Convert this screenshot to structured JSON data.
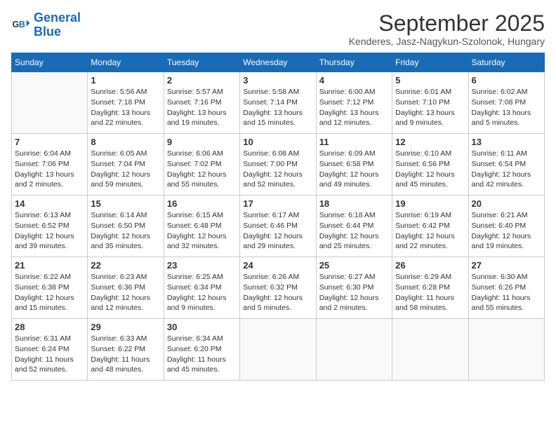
{
  "header": {
    "logo_line1": "General",
    "logo_line2": "Blue",
    "month": "September 2025",
    "location": "Kenderes, Jasz-Nagykun-Szolonok, Hungary"
  },
  "weekdays": [
    "Sunday",
    "Monday",
    "Tuesday",
    "Wednesday",
    "Thursday",
    "Friday",
    "Saturday"
  ],
  "weeks": [
    [
      {
        "day": "",
        "info": ""
      },
      {
        "day": "1",
        "info": "Sunrise: 5:56 AM\nSunset: 7:18 PM\nDaylight: 13 hours\nand 22 minutes."
      },
      {
        "day": "2",
        "info": "Sunrise: 5:57 AM\nSunset: 7:16 PM\nDaylight: 13 hours\nand 19 minutes."
      },
      {
        "day": "3",
        "info": "Sunrise: 5:58 AM\nSunset: 7:14 PM\nDaylight: 13 hours\nand 15 minutes."
      },
      {
        "day": "4",
        "info": "Sunrise: 6:00 AM\nSunset: 7:12 PM\nDaylight: 13 hours\nand 12 minutes."
      },
      {
        "day": "5",
        "info": "Sunrise: 6:01 AM\nSunset: 7:10 PM\nDaylight: 13 hours\nand 9 minutes."
      },
      {
        "day": "6",
        "info": "Sunrise: 6:02 AM\nSunset: 7:08 PM\nDaylight: 13 hours\nand 5 minutes."
      }
    ],
    [
      {
        "day": "7",
        "info": "Sunrise: 6:04 AM\nSunset: 7:06 PM\nDaylight: 13 hours\nand 2 minutes."
      },
      {
        "day": "8",
        "info": "Sunrise: 6:05 AM\nSunset: 7:04 PM\nDaylight: 12 hours\nand 59 minutes."
      },
      {
        "day": "9",
        "info": "Sunrise: 6:06 AM\nSunset: 7:02 PM\nDaylight: 12 hours\nand 55 minutes."
      },
      {
        "day": "10",
        "info": "Sunrise: 6:08 AM\nSunset: 7:00 PM\nDaylight: 12 hours\nand 52 minutes."
      },
      {
        "day": "11",
        "info": "Sunrise: 6:09 AM\nSunset: 6:58 PM\nDaylight: 12 hours\nand 49 minutes."
      },
      {
        "day": "12",
        "info": "Sunrise: 6:10 AM\nSunset: 6:56 PM\nDaylight: 12 hours\nand 45 minutes."
      },
      {
        "day": "13",
        "info": "Sunrise: 6:11 AM\nSunset: 6:54 PM\nDaylight: 12 hours\nand 42 minutes."
      }
    ],
    [
      {
        "day": "14",
        "info": "Sunrise: 6:13 AM\nSunset: 6:52 PM\nDaylight: 12 hours\nand 39 minutes."
      },
      {
        "day": "15",
        "info": "Sunrise: 6:14 AM\nSunset: 6:50 PM\nDaylight: 12 hours\nand 35 minutes."
      },
      {
        "day": "16",
        "info": "Sunrise: 6:15 AM\nSunset: 6:48 PM\nDaylight: 12 hours\nand 32 minutes."
      },
      {
        "day": "17",
        "info": "Sunrise: 6:17 AM\nSunset: 6:46 PM\nDaylight: 12 hours\nand 29 minutes."
      },
      {
        "day": "18",
        "info": "Sunrise: 6:18 AM\nSunset: 6:44 PM\nDaylight: 12 hours\nand 25 minutes."
      },
      {
        "day": "19",
        "info": "Sunrise: 6:19 AM\nSunset: 6:42 PM\nDaylight: 12 hours\nand 22 minutes."
      },
      {
        "day": "20",
        "info": "Sunrise: 6:21 AM\nSunset: 6:40 PM\nDaylight: 12 hours\nand 19 minutes."
      }
    ],
    [
      {
        "day": "21",
        "info": "Sunrise: 6:22 AM\nSunset: 6:38 PM\nDaylight: 12 hours\nand 15 minutes."
      },
      {
        "day": "22",
        "info": "Sunrise: 6:23 AM\nSunset: 6:36 PM\nDaylight: 12 hours\nand 12 minutes."
      },
      {
        "day": "23",
        "info": "Sunrise: 6:25 AM\nSunset: 6:34 PM\nDaylight: 12 hours\nand 9 minutes."
      },
      {
        "day": "24",
        "info": "Sunrise: 6:26 AM\nSunset: 6:32 PM\nDaylight: 12 hours\nand 5 minutes."
      },
      {
        "day": "25",
        "info": "Sunrise: 6:27 AM\nSunset: 6:30 PM\nDaylight: 12 hours\nand 2 minutes."
      },
      {
        "day": "26",
        "info": "Sunrise: 6:29 AM\nSunset: 6:28 PM\nDaylight: 11 hours\nand 58 minutes."
      },
      {
        "day": "27",
        "info": "Sunrise: 6:30 AM\nSunset: 6:26 PM\nDaylight: 11 hours\nand 55 minutes."
      }
    ],
    [
      {
        "day": "28",
        "info": "Sunrise: 6:31 AM\nSunset: 6:24 PM\nDaylight: 11 hours\nand 52 minutes."
      },
      {
        "day": "29",
        "info": "Sunrise: 6:33 AM\nSunset: 6:22 PM\nDaylight: 11 hours\nand 48 minutes."
      },
      {
        "day": "30",
        "info": "Sunrise: 6:34 AM\nSunset: 6:20 PM\nDaylight: 11 hours\nand 45 minutes."
      },
      {
        "day": "",
        "info": ""
      },
      {
        "day": "",
        "info": ""
      },
      {
        "day": "",
        "info": ""
      },
      {
        "day": "",
        "info": ""
      }
    ]
  ]
}
